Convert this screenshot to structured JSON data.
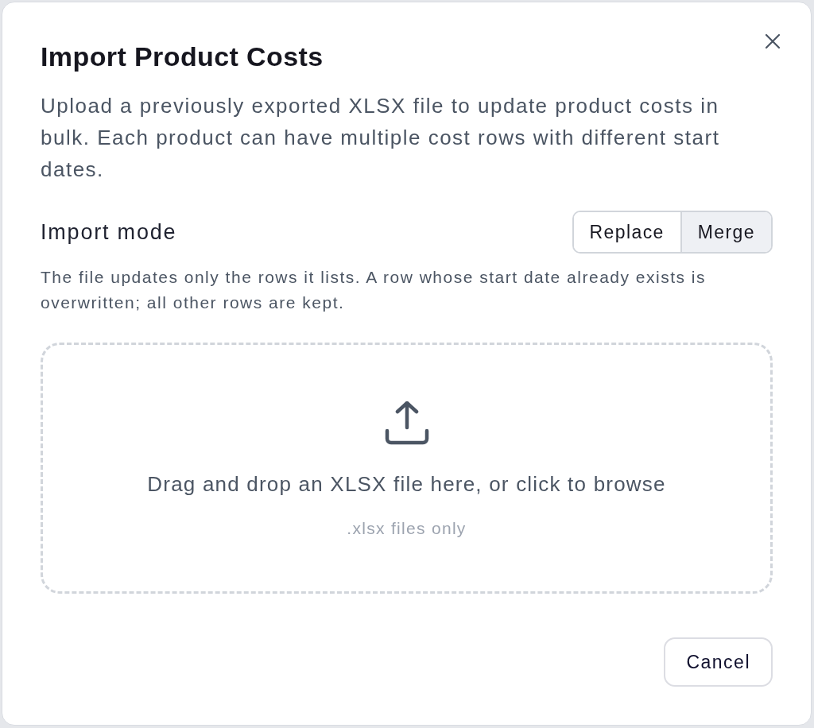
{
  "dialog": {
    "title": "Import Product Costs",
    "description": "Upload a previously exported XLSX file to update product costs in bulk. Each product can have multiple cost rows with different start dates.",
    "import_mode": {
      "label": "Import mode",
      "options": [
        {
          "label": "Replace",
          "selected": false
        },
        {
          "label": "Merge",
          "selected": true
        }
      ],
      "help": "The file updates only the rows it lists. A row whose start date already exists is overwritten; all other rows are kept."
    },
    "dropzone": {
      "prompt": "Drag and drop an XLSX file here, or click to browse",
      "hint": ".xlsx files only"
    },
    "buttons": [
      {
        "label": "Cancel"
      }
    ]
  }
}
